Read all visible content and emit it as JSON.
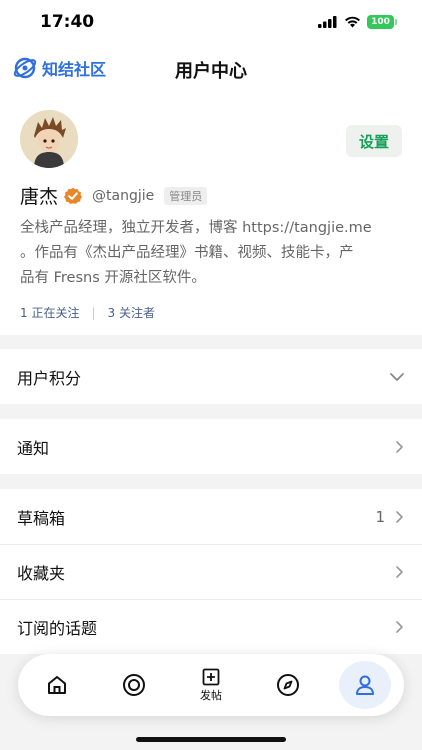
{
  "status_bar": {
    "time": "17:40",
    "battery": "100",
    "icons": [
      "signal-icon",
      "wifi-icon",
      "battery-icon"
    ]
  },
  "header": {
    "logo_text": "知结社区",
    "title": "用户中心"
  },
  "profile": {
    "name": "唐杰",
    "handle": "@tangjie",
    "role": "管理员",
    "settings_label": "设置",
    "bio_lines": [
      "全栈产品经理，独立开发者，博客 https://tangjie.me",
      "。作品有《杰出产品经理》书籍、视频、技能卡，产",
      "品有 Fresns 开源社区软件。"
    ],
    "following": "1 正在关注",
    "followers": "3 关注者"
  },
  "menu": {
    "points": "用户积分",
    "notifications": "通知",
    "drafts": "草稿箱",
    "drafts_count": "1",
    "favorites": "收藏夹",
    "subscribed_topics": "订阅的话题"
  },
  "tab_bar": {
    "post_label": "发帖",
    "tabs": [
      "home-icon",
      "target-icon",
      "post-icon",
      "compass-icon",
      "user-icon"
    ],
    "active": "user-icon"
  },
  "colors": {
    "brand": "#2f6fde",
    "settings_text": "#17a05a",
    "verified": "#e8862a",
    "link": "#4a5f8a"
  }
}
